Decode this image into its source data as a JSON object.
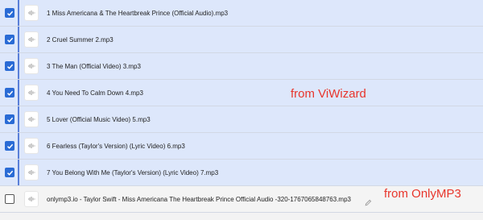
{
  "files": [
    {
      "name": "1 Miss Americana & The Heartbreak Prince (Official Audio).mp3",
      "checked": true,
      "icon": "audio-file-icon"
    },
    {
      "name": "2 Cruel Summer 2.mp3",
      "checked": true,
      "icon": "audio-file-icon"
    },
    {
      "name": "3 The Man (Official Video) 3.mp3",
      "checked": true,
      "icon": "audio-file-icon"
    },
    {
      "name": "4 You Need To Calm Down 4.mp3",
      "checked": true,
      "icon": "audio-file-icon"
    },
    {
      "name": "5 Lover (Official Music Video) 5.mp3",
      "checked": true,
      "icon": "audio-file-icon"
    },
    {
      "name": "6 Fearless (Taylor's Version) (Lyric Video) 6.mp3",
      "checked": true,
      "icon": "audio-file-icon"
    },
    {
      "name": "7 You Belong With Me (Taylor's Version) (Lyric Video) 7.mp3",
      "checked": true,
      "icon": "audio-file-icon"
    },
    {
      "name": "onlymp3.io - Taylor Swift - Miss Americana The Heartbreak Prince Official Audio -320-1767065848763.mp3",
      "checked": false,
      "icon": "audio-file-icon",
      "editable": true
    }
  ],
  "annotations": {
    "viwizard": "from ViWizard",
    "onlymp3": "from OnlyMP3"
  },
  "colors": {
    "selected_row": "#dde7fb",
    "checkbox_blue": "#2a6bd5",
    "annotation_red": "#e8352b"
  }
}
